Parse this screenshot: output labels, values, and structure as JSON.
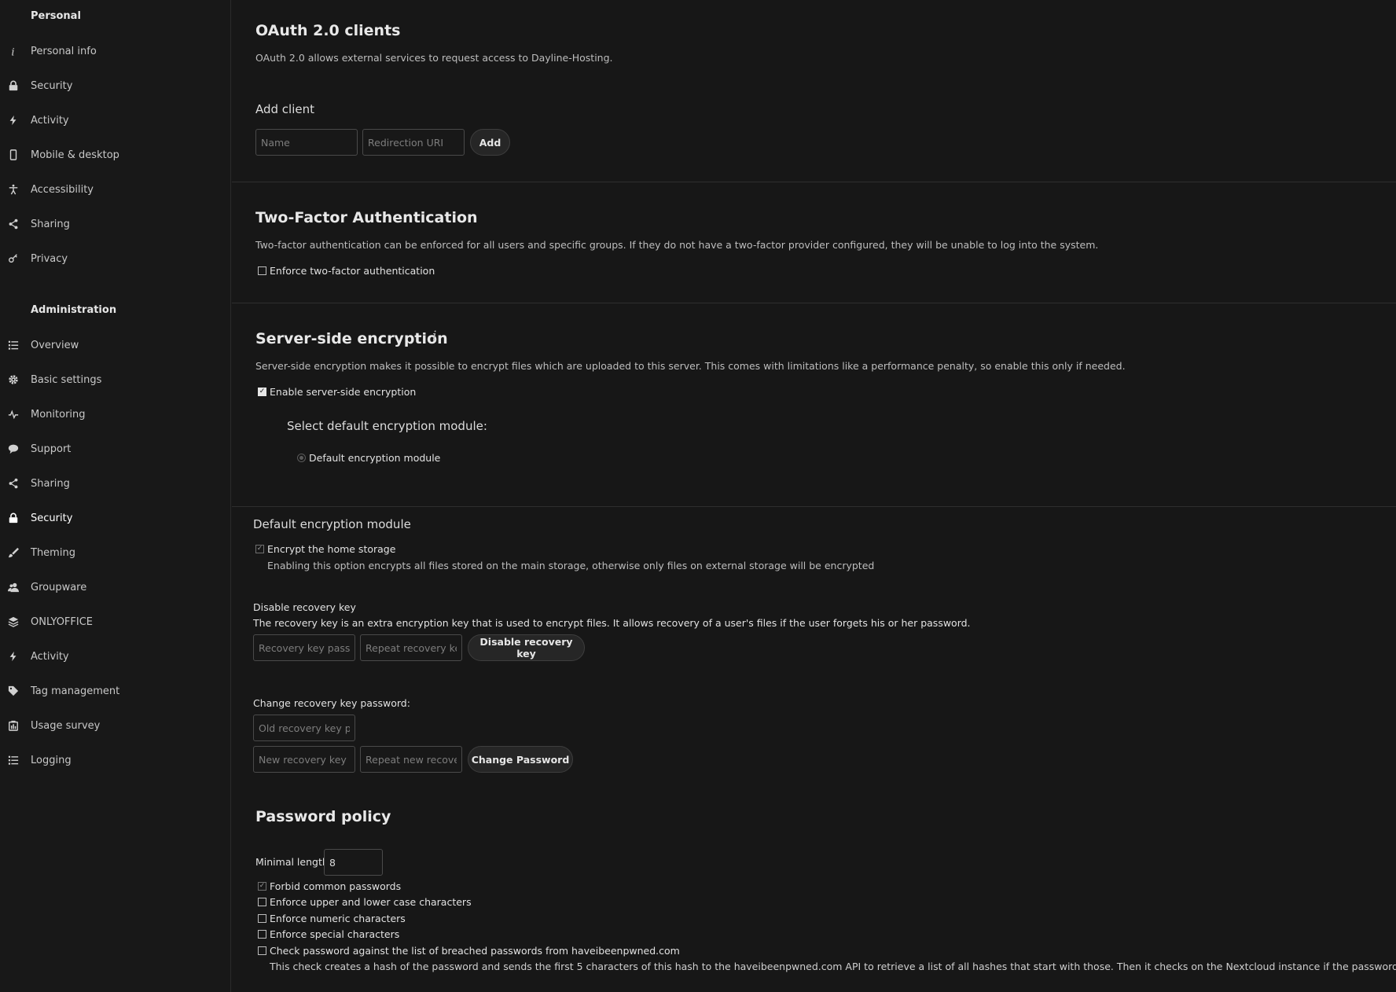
{
  "sidebar": {
    "personal_caption": "Personal",
    "personal_items": [
      {
        "label": "Personal info",
        "icon": "info-icon"
      },
      {
        "label": "Security",
        "icon": "lock-icon"
      },
      {
        "label": "Activity",
        "icon": "lightning-icon"
      },
      {
        "label": "Mobile & desktop",
        "icon": "phone-icon"
      },
      {
        "label": "Accessibility",
        "icon": "accessibility-icon"
      },
      {
        "label": "Sharing",
        "icon": "share-icon"
      },
      {
        "label": "Privacy",
        "icon": "key-icon"
      }
    ],
    "admin_caption": "Administration",
    "admin_items": [
      {
        "label": "Overview",
        "icon": "list-icon"
      },
      {
        "label": "Basic settings",
        "icon": "gear-icon"
      },
      {
        "label": "Monitoring",
        "icon": "pulse-icon"
      },
      {
        "label": "Support",
        "icon": "chat-icon"
      },
      {
        "label": "Sharing",
        "icon": "share-icon"
      },
      {
        "label": "Security",
        "icon": "lock-icon",
        "active": true
      },
      {
        "label": "Theming",
        "icon": "paintbrush-icon"
      },
      {
        "label": "Groupware",
        "icon": "group-icon"
      },
      {
        "label": "ONLYOFFICE",
        "icon": "layers-icon"
      },
      {
        "label": "Activity",
        "icon": "lightning-icon"
      },
      {
        "label": "Tag management",
        "icon": "tag-icon"
      },
      {
        "label": "Usage survey",
        "icon": "survey-icon"
      },
      {
        "label": "Logging",
        "icon": "list-icon"
      }
    ]
  },
  "oauth": {
    "title": "OAuth 2.0 clients",
    "description": "OAuth 2.0 allows external services to request access to Dayline-Hosting.",
    "add_client_title": "Add client",
    "name_placeholder": "Name",
    "redirect_placeholder": "Redirection URI",
    "add_button": "Add"
  },
  "twofactor": {
    "title": "Two-Factor Authentication",
    "description": "Two-factor authentication can be enforced for all users and specific groups. If they do not have a two-factor provider configured, they will be unable to log into the system.",
    "enforce_label": "Enforce two-factor authentication"
  },
  "encryption": {
    "title": "Server-side encryption",
    "description": "Server-side encryption makes it possible to encrypt files which are uploaded to this server. This comes with limitations like a performance penalty, so enable this only if needed.",
    "enable_label": "Enable server-side encryption",
    "select_module_title": "Select default encryption module:",
    "module_option": "Default encryption module"
  },
  "default_module": {
    "title": "Default encryption module",
    "encrypt_home_label": "Encrypt the home storage",
    "encrypt_home_desc": "Enabling this option encrypts all files stored on the main storage, otherwise only files on external storage will be encrypted",
    "disable_recovery_title": "Disable recovery key",
    "disable_recovery_desc": "The recovery key is an extra encryption key that is used to encrypt files. It allows recovery of a user's files if the user forgets his or her password.",
    "recovery_pass_placeholder": "Recovery key password",
    "repeat_recovery_placeholder": "Repeat recovery key password",
    "disable_button": "Disable recovery key",
    "change_title": "Change recovery key password:",
    "old_placeholder": "Old recovery key password",
    "new_placeholder": "New recovery key password",
    "repeat_new_placeholder": "Repeat new recovery key password",
    "change_button": "Change Password"
  },
  "password_policy": {
    "title": "Password policy",
    "min_length_label": "Minimal length",
    "min_length_value": "8",
    "forbid_common": "Forbid common passwords",
    "upper_lower": "Enforce upper and lower case characters",
    "numeric": "Enforce numeric characters",
    "special": "Enforce special characters",
    "breached": "Check password against the list of breached passwords from haveibeenpwned.com",
    "breached_desc": "This check creates a hash of the password and sends the first 5 characters of this hash to the haveibeenpwned.com API to retrieve a list of all hashes that start with those. Then it checks on the Nextcloud instance if the password hash is in the result set."
  }
}
